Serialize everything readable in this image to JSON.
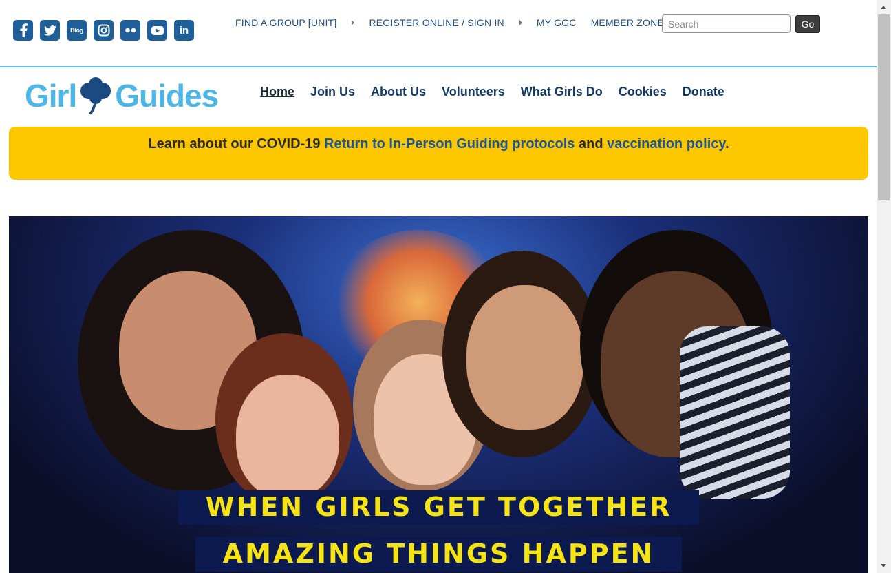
{
  "social": {
    "items": [
      {
        "name": "facebook",
        "label": ""
      },
      {
        "name": "twitter",
        "label": ""
      },
      {
        "name": "blog",
        "label": "Blog"
      },
      {
        "name": "instagram",
        "label": ""
      },
      {
        "name": "flickr",
        "label": ""
      },
      {
        "name": "youtube",
        "label": ""
      },
      {
        "name": "linkedin",
        "label": "in"
      }
    ],
    "color": "#1f5f99"
  },
  "utility_nav": {
    "find_group": "FIND A GROUP [UNIT]",
    "register": "REGISTER ONLINE / SIGN IN",
    "my_ggc": "MY GGC",
    "member_zone": "MEMBER ZONE"
  },
  "search": {
    "placeholder": "Search",
    "value": "",
    "button_label": "Go"
  },
  "logo": {
    "left_word": "Girl",
    "right_word": "Guides",
    "color": "#4cb6e6"
  },
  "main_nav": {
    "items": [
      "Home",
      "Join Us",
      "About Us",
      "Volunteers",
      "What Girls Do",
      "Cookies",
      "Donate"
    ],
    "active": "Home"
  },
  "alert": {
    "prefix": "Learn about our COVID-19 ",
    "link1": "Return to In-Person Guiding protocols",
    "middle": " and ",
    "link2": "vaccination policy",
    "suffix": ".",
    "background": "#fdc700"
  },
  "hero": {
    "caption_line1": "WHEN GIRLS GET TOGETHER",
    "caption_line2": "AMAZING THINGS HAPPEN",
    "caption_color": "#f5e314"
  }
}
